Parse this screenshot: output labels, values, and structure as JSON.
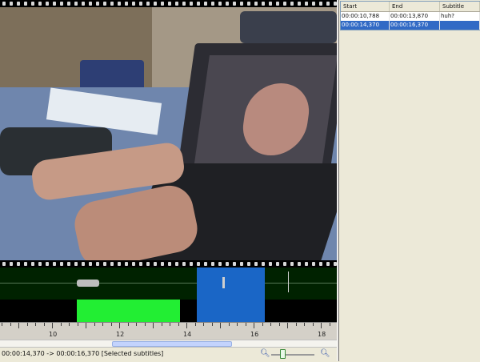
{
  "subtitle_table": {
    "columns": [
      "Start",
      "End",
      "Subtitle"
    ],
    "rows": [
      {
        "start": "00:00:10,788",
        "end": "00:00:13,870",
        "text": "huh?",
        "selected": false
      },
      {
        "start": "00:00:14,370",
        "end": "00:00:16,370",
        "text": "",
        "selected": true
      }
    ]
  },
  "timeline": {
    "ticks": [
      "10",
      "12",
      "14",
      "16",
      "18"
    ]
  },
  "status_bar": {
    "text": "00:00:14,370 -> 00:00:16,370 [Selected subtitles]"
  },
  "zoom": {
    "out_icon": "zoom-out-icon",
    "in_icon": "zoom-in-icon",
    "level": 0.3
  },
  "colors": {
    "selection": "#1a66c6",
    "subtitle_block": "#22ee33",
    "grid_selection": "#316ac5"
  }
}
